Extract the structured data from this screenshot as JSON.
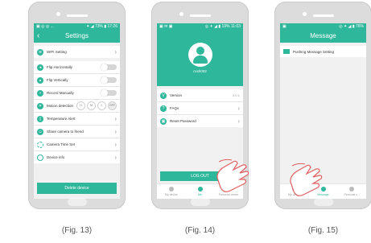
{
  "fig13": {
    "status": {
      "left": "▣ ◎ ◎ ...",
      "right": "✦ ◢ 73% ▮ 17:26"
    },
    "title": "Settings",
    "rows": [
      {
        "label": "WIFI Setting",
        "icon": "wifi-icon",
        "control": "chevron"
      },
      {
        "label": "Flip Horizontally",
        "icon": "flip-horizontal-icon",
        "control": "toggle"
      },
      {
        "label": "Flip Vertically",
        "icon": "flip-vertical-icon",
        "control": "toggle"
      },
      {
        "label": "Record Manually",
        "icon": "record-icon",
        "control": "toggle"
      },
      {
        "label": "Motion detection",
        "icon": "motion-icon",
        "control": "levels"
      },
      {
        "label": "Temperature Alert",
        "icon": "temperature-icon",
        "control": "chevron"
      },
      {
        "label": "Share camera to friend",
        "icon": "share-icon",
        "control": "chevron"
      },
      {
        "label": "Camera Time Set",
        "icon": "clock-icon",
        "control": "chevron"
      },
      {
        "label": "Device info",
        "icon": "info-icon",
        "control": "chevron"
      }
    ],
    "motion_levels": [
      "H",
      "M",
      "L",
      "OFF"
    ],
    "delete_label": "Delete device",
    "caption": "(Fig. 13)"
  },
  "fig14": {
    "status": {
      "left": "▣ ✉ ▣",
      "right": "◎ ✦ ◢ ▮ 19% 11:03"
    },
    "username": "cxxh002",
    "rows": [
      {
        "label": "Version",
        "icon": "version-icon",
        "value": "2.0.1"
      },
      {
        "label": "FAQs",
        "icon": "faq-icon",
        "value": ""
      },
      {
        "label": "Reset Password",
        "icon": "lock-icon",
        "value": ""
      }
    ],
    "logout_label": "LOG OUT",
    "tabs": [
      "My device",
      "Me",
      "Personal center"
    ],
    "caption": "(Fig. 14)"
  },
  "fig15": {
    "status": {
      "left": "▣",
      "right": "◎ ✦ ◢ ▮ 76%"
    },
    "title": "Message",
    "item": "Pushing Message Setting",
    "tabs": [
      "My device",
      "Message",
      "Personal c..."
    ],
    "caption": "(Fig. 15)"
  }
}
